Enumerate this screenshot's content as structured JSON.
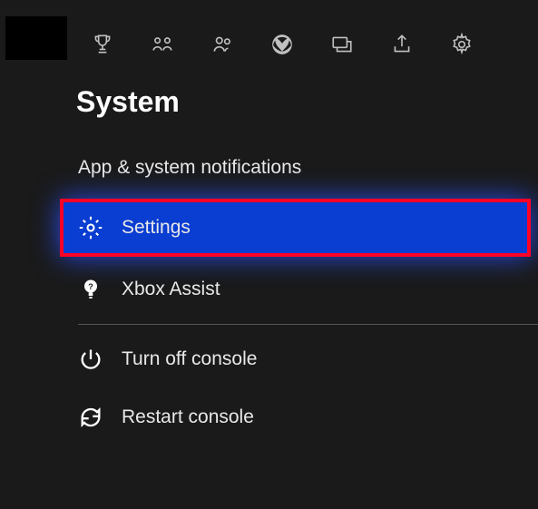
{
  "page_title": "System",
  "menu": {
    "notifications_label": "App & system notifications",
    "settings_label": "Settings",
    "xbox_assist_label": "Xbox Assist",
    "turn_off_label": "Turn off console",
    "restart_label": "Restart console"
  }
}
